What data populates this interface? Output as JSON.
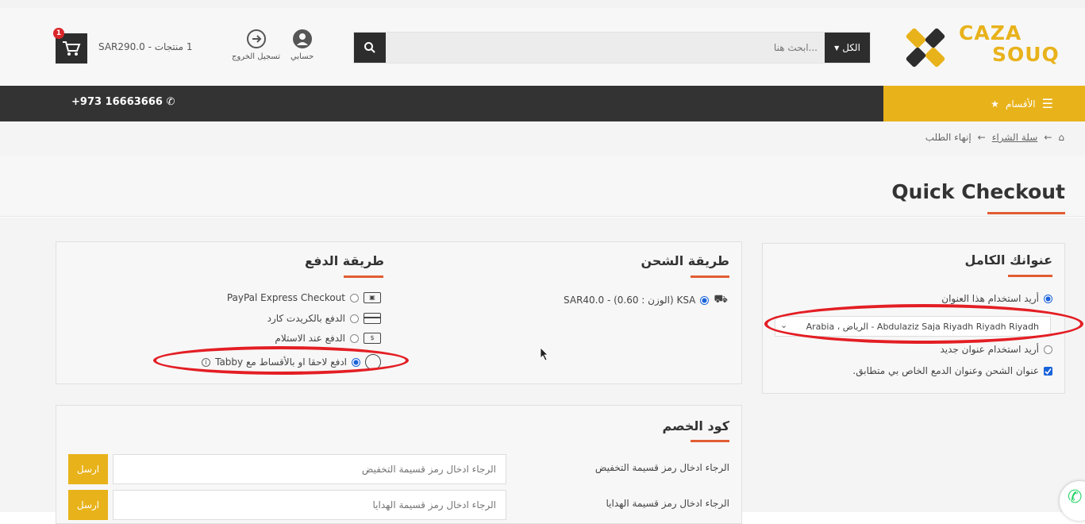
{
  "brand": {
    "line1": "CAZA",
    "line2": "SOUQ"
  },
  "search": {
    "placeholder": "...ابحث هنا",
    "category": "الكل"
  },
  "account": {
    "my_account": "حسابي",
    "logout": "تسجيل الخروج"
  },
  "cart": {
    "count": "1",
    "summary": "1 منتجات - SAR290.0"
  },
  "nav": {
    "categories": "الأقسام",
    "phone": "+973 16663666"
  },
  "breadcrumb": {
    "cart": "سلة الشراء",
    "checkout": "إنهاء الطلب"
  },
  "page": {
    "title": "Quick Checkout"
  },
  "address": {
    "title": "عنوانك الكامل",
    "use_existing": "أريد استخدام هذا العنوان",
    "selected": "Arabia ، الرياض - Abdulaziz Saja Riyadh Riyadh Riyadh",
    "use_new": "أريد استخدام عنوان جديد",
    "same_address": "عنوان الشحن وعنوان الدمع الخاص بي متطابق."
  },
  "shipping": {
    "title": "طريقة الشحن",
    "option": "KSA (الوزن : 0.60) - SAR40.0"
  },
  "payment": {
    "title": "طريقة الدفع",
    "options": [
      {
        "label": "PayPal Express Checkout",
        "selected": false
      },
      {
        "label": "الدفع بالكريدت كارد",
        "selected": false
      },
      {
        "label": "الدفع عند الاستلام",
        "selected": false
      },
      {
        "label": "ادفع لاحقا او بالأقساط مع Tabby",
        "selected": true
      }
    ]
  },
  "coupon": {
    "title": "كود الخصم",
    "discount_label": "الرجاء ادخال رمز قسيمة التخفيض",
    "discount_placeholder": "الرجاء ادخال رمز قسيمة التخفيض",
    "gift_label": "الرجاء ادخال رمز قسيمة الهدايا",
    "gift_placeholder": "الرجاء ادخال رمز قسيمة الهدايا",
    "send": "ارسل"
  },
  "colors": {
    "accent": "#e8b21a",
    "dark": "#333333",
    "underline": "#e25d33",
    "highlight": "#e31e24"
  }
}
